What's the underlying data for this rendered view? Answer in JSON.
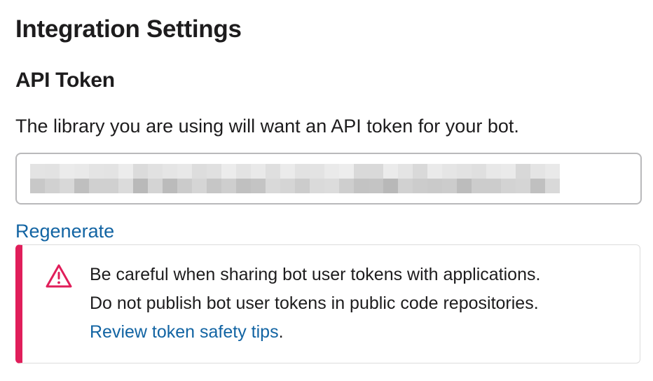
{
  "page": {
    "title": "Integration Settings"
  },
  "api_token": {
    "heading": "API Token",
    "description": "The library you are using will want an API token for your bot.",
    "regenerate_label": "Regenerate"
  },
  "warning": {
    "icon": "warning-triangle-icon",
    "line1": "Be careful when sharing bot user tokens with applications.",
    "line2": "Do not publish bot user tokens in public code repositories.",
    "link_text": "Review token safety tips",
    "link_suffix": "."
  },
  "colors": {
    "link": "#1264a3",
    "warning_accent": "#e01e5a",
    "text": "#1d1c1d"
  }
}
